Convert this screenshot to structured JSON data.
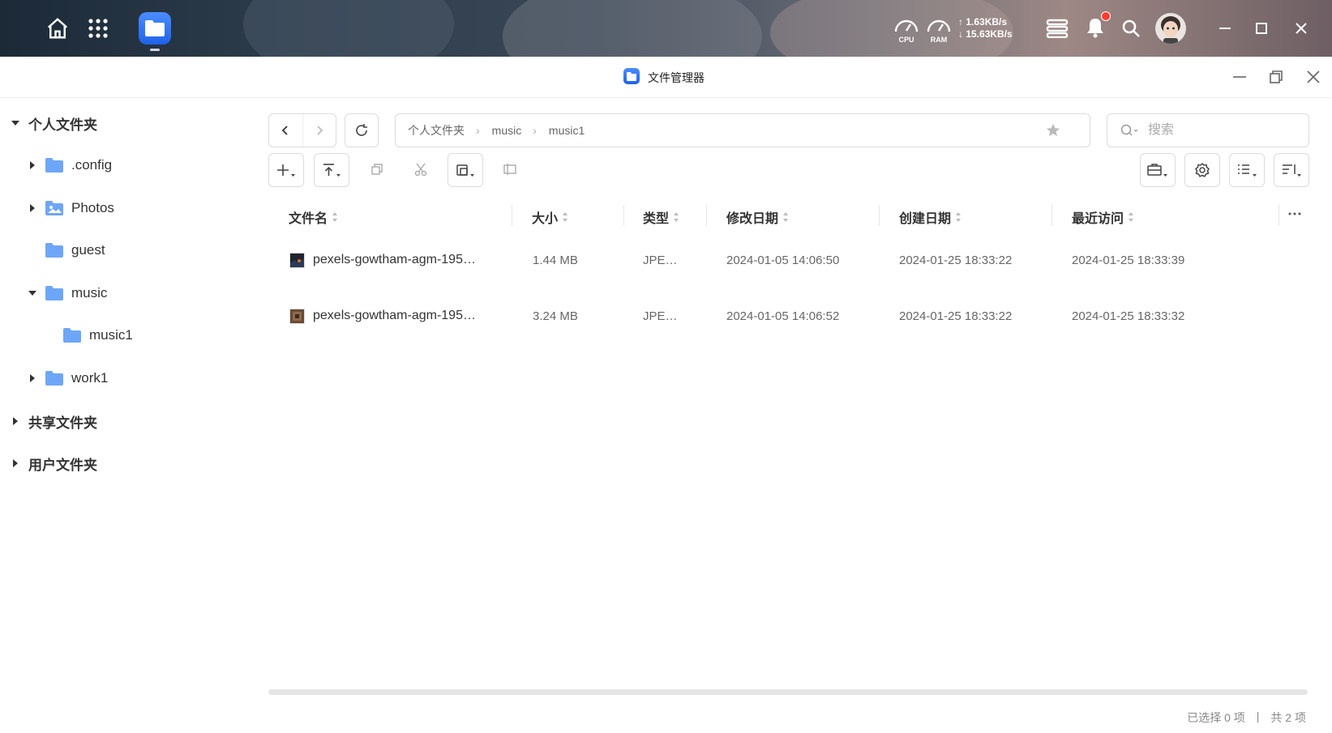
{
  "taskbar": {
    "home_icon": "home-icon",
    "apps_icon": "grid-icon",
    "active_app_icon": "folder-icon",
    "cpu_label": "CPU",
    "ram_label": "RAM",
    "upload_speed": "↑ 1.63KB/s",
    "download_speed": "↓ 15.63KB/s"
  },
  "window": {
    "title": "文件管理器"
  },
  "sidebar": {
    "personal": "个人文件夹",
    "items": [
      {
        "label": ".config"
      },
      {
        "label": "Photos"
      },
      {
        "label": "guest"
      },
      {
        "label": "music"
      },
      {
        "label": "music1"
      },
      {
        "label": "work1"
      }
    ],
    "shared": "共享文件夹",
    "users": "用户文件夹"
  },
  "path": {
    "crumbs": [
      "个人文件夹",
      "music",
      "music1"
    ]
  },
  "search": {
    "placeholder": "搜索"
  },
  "table": {
    "headers": [
      "文件名",
      "大小",
      "类型",
      "修改日期",
      "创建日期",
      "最近访问"
    ],
    "rows": [
      {
        "name": "pexels-gowtham-agm-195…",
        "size": "1.44 MB",
        "type": "JPE…",
        "modified": "2024-01-05 14:06:50",
        "created": "2024-01-25 18:33:22",
        "accessed": "2024-01-25 18:33:39"
      },
      {
        "name": "pexels-gowtham-agm-195…",
        "size": "3.24 MB",
        "type": "JPE…",
        "modified": "2024-01-05 14:06:52",
        "created": "2024-01-25 18:33:22",
        "accessed": "2024-01-25 18:33:32"
      }
    ]
  },
  "status": {
    "selected": "已选择 0 项",
    "divider": "|",
    "total": "共 2 项"
  },
  "colors": {
    "accent": "#2f6ef6",
    "folder": "#6ea6f7",
    "notification": "#ff3b30"
  }
}
